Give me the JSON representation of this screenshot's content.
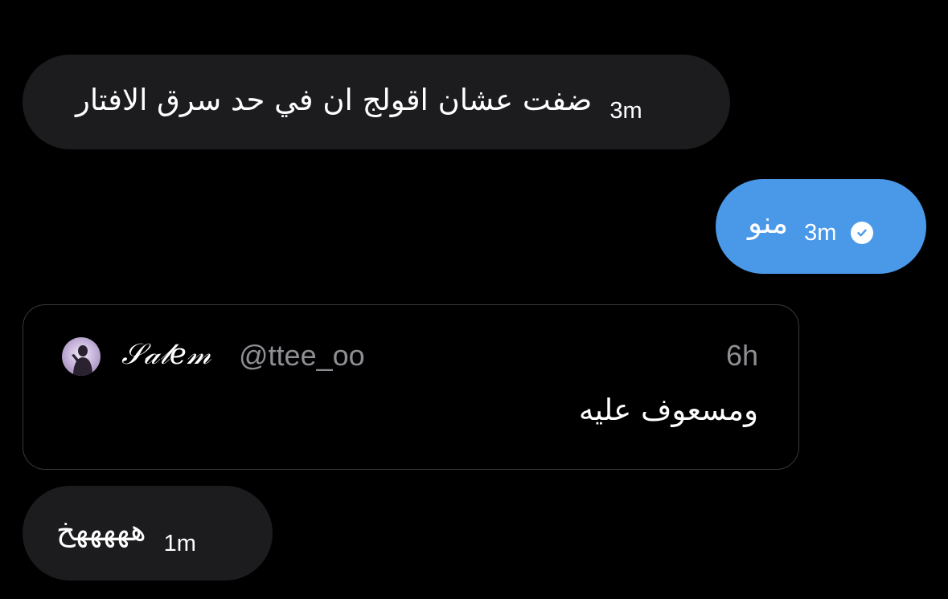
{
  "messages": [
    {
      "text": "ضفت عشان اقولج ان في حد سرق الافتار",
      "time": "3m",
      "direction": "incoming"
    },
    {
      "text": "منو",
      "time": "3m",
      "direction": "outgoing",
      "status_icon": "read-check-icon"
    },
    {
      "text": "هههههخ",
      "time": "1m",
      "direction": "incoming"
    }
  ],
  "quoted_post": {
    "display_name": "𝒮𝒶𝓁𝑒𝓂",
    "handle": "@ttee_oo",
    "time": "6h",
    "text": "ومسعوف عليه",
    "avatar_icon": "profile-avatar"
  },
  "colors": {
    "background": "#000000",
    "incoming_bubble": "#1c1c1e",
    "outgoing_bubble": "#4a99e9",
    "secondary_text": "#8e8e93",
    "quote_border": "#3a3a3c"
  }
}
